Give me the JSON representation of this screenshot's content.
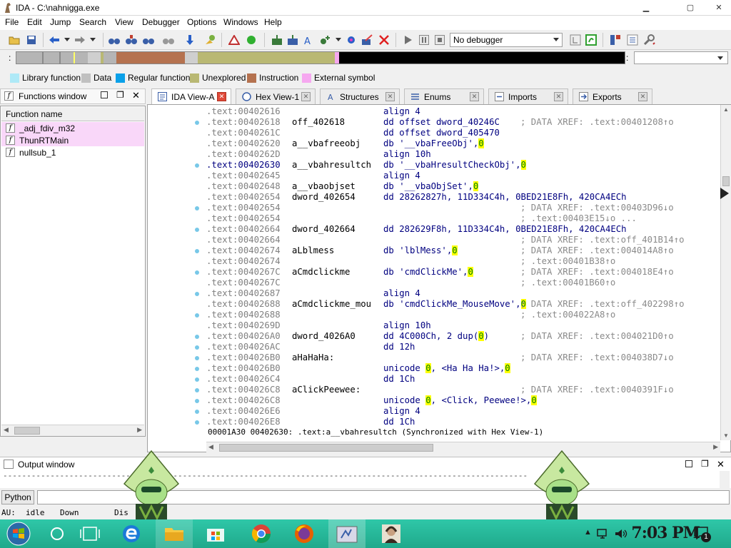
{
  "window": {
    "title": "IDA - C:\\nahnigga.exe",
    "min": "▁",
    "max": "▢",
    "close": "✕"
  },
  "menu": [
    "File",
    "Edit",
    "Jump",
    "Search",
    "View",
    "Debugger",
    "Options",
    "Windows",
    "Help"
  ],
  "toolbar": {
    "debugger_value": "No debugger"
  },
  "legend": [
    {
      "label": "Library function",
      "color": "#aee9f7"
    },
    {
      "label": "Data",
      "color": "#c0c0c0"
    },
    {
      "label": "Regular function",
      "color": "#0aa0e8"
    },
    {
      "label": "Unexplored",
      "color": "#b9b873"
    },
    {
      "label": "Instruction",
      "color": "#b5724f"
    },
    {
      "label": "External symbol",
      "color": "#f6a8f0"
    }
  ],
  "functions_window": {
    "title": "Functions window",
    "column": "Function name",
    "items": [
      "_adj_fdiv_m32",
      "ThunRTMain",
      "nullsub_1"
    ]
  },
  "tabs": [
    {
      "label": "IDA View-A",
      "active": true
    },
    {
      "label": "Hex View-1",
      "active": false
    },
    {
      "label": "Structures",
      "active": false
    },
    {
      "label": "Enums",
      "active": false
    },
    {
      "label": "Imports",
      "active": false
    },
    {
      "label": "Exports",
      "active": false
    }
  ],
  "disasm": [
    {
      "addr": ".text:00402616",
      "label": "",
      "ins": "align 4",
      "cmt": ""
    },
    {
      "addr": ".text:00402618",
      "label": "off_402618",
      "ins": "dd offset dword_40246C",
      "cmt": "; DATA XREF: .text:00401208↑o"
    },
    {
      "addr": ".text:0040261C",
      "label": "",
      "ins": "dd offset dword_405470",
      "cmt": ""
    },
    {
      "addr": ".text:00402620",
      "label": "a__vbafreeobj",
      "ins": "db '__vbaFreeObj',",
      "z": "0",
      "cmt": ""
    },
    {
      "addr": ".text:0040262D",
      "label": "",
      "ins": "align 10h",
      "cmt": ""
    },
    {
      "addr": ".text:00402630",
      "label": "a__vbahresultch",
      "ins": "db '__vbaHresultCheckObj',",
      "z": "0",
      "cmt": "",
      "current": true
    },
    {
      "addr": ".text:00402645",
      "label": "",
      "ins": "align 4",
      "cmt": ""
    },
    {
      "addr": ".text:00402648",
      "label": "a__vbaobjset",
      "ins": "db '__vbaObjSet',",
      "z": "0",
      "cmt": ""
    },
    {
      "addr": ".text:00402654",
      "label": "dword_402654",
      "ins": "dd 28262827h, 11D334C4h, 0BED21E8Fh, 420CA4ECh",
      "cmt": ""
    },
    {
      "addr": ".text:00402654",
      "label": "",
      "ins": "",
      "cmt": "; DATA XREF: .text:00403D96↓o"
    },
    {
      "addr": ".text:00402654",
      "label": "",
      "ins": "",
      "cmt": "; .text:00403E15↓o ..."
    },
    {
      "addr": ".text:00402664",
      "label": "dword_402664",
      "ins": "dd 282629F8h, 11D334C4h, 0BED21E8Fh, 420CA4ECh",
      "cmt": ""
    },
    {
      "addr": ".text:00402664",
      "label": "",
      "ins": "",
      "cmt": "; DATA XREF: .text:off_401B14↑o"
    },
    {
      "addr": ".text:00402674",
      "label": "aLblmess",
      "ins": "db 'lblMess',",
      "z": "0",
      "cmt": "; DATA XREF: .text:004014A8↑o"
    },
    {
      "addr": ".text:00402674",
      "label": "",
      "ins": "",
      "cmt": "; .text:00401B38↑o"
    },
    {
      "addr": ".text:0040267C",
      "label": "aCmdclickme",
      "ins": "db 'cmdClickMe',",
      "z": "0",
      "cmt": "; DATA XREF: .text:004018E4↑o"
    },
    {
      "addr": ".text:0040267C",
      "label": "",
      "ins": "",
      "cmt": "; .text:00401B60↑o"
    },
    {
      "addr": ".text:00402687",
      "label": "",
      "ins": "align 4",
      "cmt": ""
    },
    {
      "addr": ".text:00402688",
      "label": "aCmdclickme_mou",
      "ins": "db 'cmdClickMe_MouseMove',",
      "z": "0",
      "cmt": "; DATA XREF: .text:off_402298↑o"
    },
    {
      "addr": ".text:00402688",
      "label": "",
      "ins": "",
      "cmt": "; .text:004022A8↑o"
    },
    {
      "addr": ".text:0040269D",
      "label": "",
      "ins": "align 10h",
      "cmt": ""
    },
    {
      "addr": ".text:004026A0",
      "label": "dword_4026A0",
      "ins": "dd 4C000Ch, 2 dup(",
      "z": "0",
      "tail": ")",
      "cmt": "; DATA XREF: .text:004021D0↑o"
    },
    {
      "addr": ".text:004026AC",
      "label": "",
      "ins": "dd 12h",
      "cmt": ""
    },
    {
      "addr": ".text:004026B0",
      "label": "aHaHaHa:",
      "ins": "",
      "cmt": "; DATA XREF: .text:004038D7↓o"
    },
    {
      "addr": ".text:004026B0",
      "label": "",
      "ins": "unicode ",
      "z": "0",
      "tail": ", <Ha Ha Ha!>,",
      "z2": "0",
      "cmt": ""
    },
    {
      "addr": ".text:004026C4",
      "label": "",
      "ins": "dd 1Ch",
      "cmt": ""
    },
    {
      "addr": ".text:004026C8",
      "label": "aClickPeewee:",
      "ins": "",
      "cmt": "; DATA XREF: .text:0040391F↓o"
    },
    {
      "addr": ".text:004026C8",
      "label": "",
      "ins": "unicode ",
      "z": "0",
      "tail": ", <Click, Peewee!>,",
      "z2": "0",
      "cmt": ""
    },
    {
      "addr": ".text:004026E6",
      "label": "",
      "ins": "align 4",
      "cmt": ""
    },
    {
      "addr": ".text:004026E8",
      "label": "",
      "ins": "dd 1Ch",
      "cmt": ""
    }
  ],
  "disasm_status": "00001A30 00402630: .text:a__vbahresultch (Synchronized with Hex View-1)",
  "output": {
    "title": "Output window",
    "text": "---------------------------------------------------------------------------------------------------------------",
    "python_label": "Python"
  },
  "status": {
    "au": "AU:",
    "state": "idle",
    "dir": "Down",
    "disk": "Dis"
  },
  "taskbar": {
    "clock": "7:03 PM",
    "notif": "1"
  }
}
